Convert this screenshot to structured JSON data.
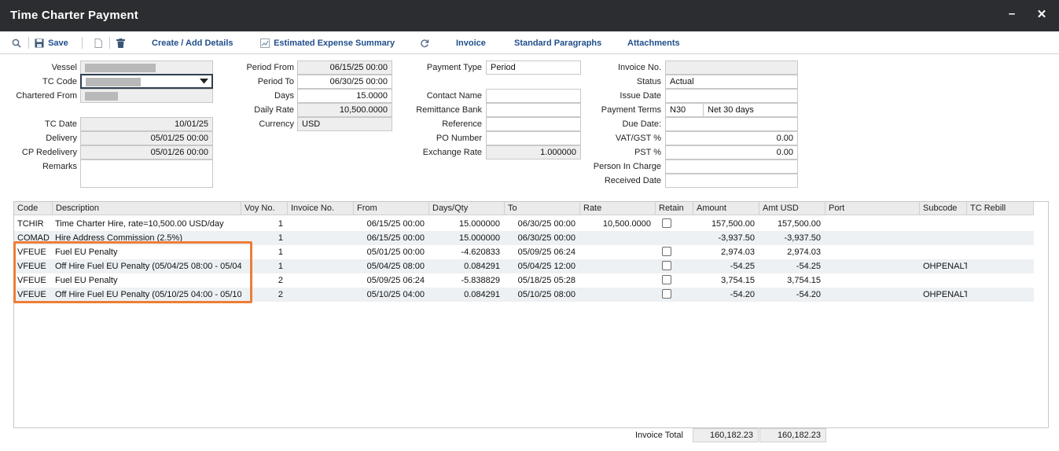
{
  "window": {
    "title": "Time Charter Payment",
    "minimize_glyph": "–",
    "close_glyph": "✕"
  },
  "toolbar": {
    "save": "Save",
    "create_add_details": "Create / Add Details",
    "estimated_expense_summary": "Estimated Expense Summary",
    "invoice": "Invoice",
    "standard_paragraphs": "Standard Paragraphs",
    "attachments": "Attachments"
  },
  "form": {
    "vessel_label": "Vessel",
    "tc_code_label": "TC Code",
    "chartered_from_label": "Chartered From",
    "tc_date_label": "TC Date",
    "tc_date": "10/01/25",
    "delivery_label": "Delivery",
    "delivery": "05/01/25 00:00",
    "cp_redelivery_label": "CP Redelivery",
    "cp_redelivery": "05/01/26 00:00",
    "remarks_label": "Remarks",
    "remarks": "",
    "period_from_label": "Period From",
    "period_from": "06/15/25 00:00",
    "period_to_label": "Period To",
    "period_to": "06/30/25 00:00",
    "days_label": "Days",
    "days": "15.0000",
    "daily_rate_label": "Daily Rate",
    "daily_rate": "10,500.0000",
    "currency_label": "Currency",
    "currency": "USD",
    "payment_type_label": "Payment Type",
    "payment_type": "Period",
    "contact_name_label": "Contact Name",
    "contact_name": "",
    "remittance_bank_label": "Remittance Bank",
    "remittance_bank": "",
    "reference_label": "Reference",
    "reference": "",
    "po_number_label": "PO Number",
    "po_number": "",
    "exchange_rate_label": "Exchange Rate",
    "exchange_rate": "1.000000",
    "invoice_no_label": "Invoice No.",
    "invoice_no": "",
    "status_label": "Status",
    "status": "Actual",
    "issue_date_label": "Issue Date",
    "issue_date": "",
    "payment_terms_label": "Payment Terms",
    "payment_terms_code": "N30",
    "payment_terms_desc": "Net 30 days",
    "due_date_label": "Due Date:",
    "due_date": "",
    "vat_gst_label": "VAT/GST %",
    "vat_gst": "0.00",
    "pst_label": "PST %",
    "pst": "0.00",
    "person_in_charge_label": "Person In Charge",
    "person_in_charge": "",
    "received_date_label": "Received Date",
    "received_date": ""
  },
  "grid": {
    "columns": [
      "Code",
      "Description",
      "Voy No.",
      "Invoice No.",
      "From",
      "Days/Qty",
      "To",
      "Rate",
      "Retain",
      "Amount",
      "Amt USD",
      "Port",
      "Subcode",
      "TC Rebill"
    ],
    "rows": [
      {
        "code": "TCHIR",
        "description": "Time Charter Hire, rate=10,500.00 USD/day",
        "voy": "1",
        "invoice_no": "",
        "from": "06/15/25 00:00",
        "days_qty": "15.000000",
        "to": "06/30/25 00:00",
        "rate": "10,500.0000",
        "retain": false,
        "amount": "157,500.00",
        "amt_usd": "157,500.00",
        "port": "",
        "subcode": "",
        "tc_rebill": ""
      },
      {
        "code": "COMAD",
        "description": "Hire Address Commission (2.5%)",
        "voy": "1",
        "invoice_no": "",
        "from": "06/15/25 00:00",
        "days_qty": "15.000000",
        "to": "06/30/25 00:00",
        "rate": "",
        "retain": null,
        "amount": "-3,937.50",
        "amt_usd": "-3,937.50",
        "port": "",
        "subcode": "",
        "tc_rebill": ""
      },
      {
        "code": "VFEUE",
        "description": "Fuel EU Penalty",
        "voy": "1",
        "invoice_no": "",
        "from": "05/01/25 00:00",
        "days_qty": "-4.620833",
        "to": "05/09/25 06:24",
        "rate": "",
        "retain": false,
        "amount": "2,974.03",
        "amt_usd": "2,974.03",
        "port": "",
        "subcode": "",
        "tc_rebill": ""
      },
      {
        "code": "VFEUE",
        "description": "Off Hire Fuel EU Penalty (05/04/25 08:00 - 05/04",
        "voy": "1",
        "invoice_no": "",
        "from": "05/04/25 08:00",
        "days_qty": "0.084291",
        "to": "05/04/25 12:00",
        "rate": "",
        "retain": false,
        "amount": "-54.25",
        "amt_usd": "-54.25",
        "port": "",
        "subcode": "OHPENALT",
        "tc_rebill": ""
      },
      {
        "code": "VFEUE",
        "description": "Fuel EU Penalty",
        "voy": "2",
        "invoice_no": "",
        "from": "05/09/25 06:24",
        "days_qty": "-5.838829",
        "to": "05/18/25 05:28",
        "rate": "",
        "retain": false,
        "amount": "3,754.15",
        "amt_usd": "3,754.15",
        "port": "",
        "subcode": "",
        "tc_rebill": ""
      },
      {
        "code": "VFEUE",
        "description": "Off Hire Fuel EU Penalty (05/10/25 04:00 - 05/10",
        "voy": "2",
        "invoice_no": "",
        "from": "05/10/25 04:00",
        "days_qty": "0.084291",
        "to": "05/10/25 08:00",
        "rate": "",
        "retain": false,
        "amount": "-54.20",
        "amt_usd": "-54.20",
        "port": "",
        "subcode": "OHPENALT",
        "tc_rebill": ""
      }
    ]
  },
  "totals": {
    "label": "Invoice Total",
    "amount": "160,182.23",
    "amt_usd": "160,182.23"
  },
  "colors": {
    "titlebar": "#2b2d30",
    "link": "#1f4e8c",
    "highlight": "#ee7e36",
    "alt_row": "#edf1f4"
  }
}
